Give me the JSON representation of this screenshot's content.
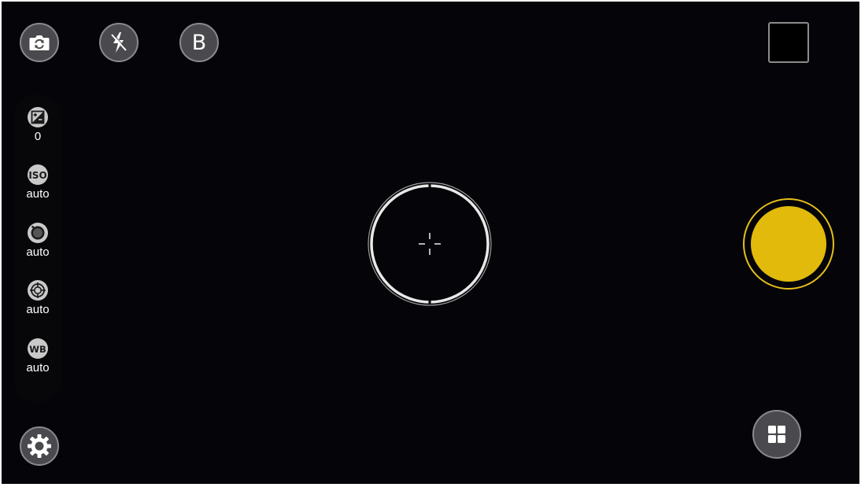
{
  "colors": {
    "viewfinder_bg": "#050408",
    "button_bg": "#4a4a4e",
    "button_border": "#8a8a8e",
    "shutter": "#e1ba0b",
    "shutter_ring": "#e6bf1a"
  },
  "top_bar": {
    "switch_camera_icon": "camera-switch-icon",
    "flash_icon": "flash-auto-icon",
    "mode_label": "B",
    "gallery_thumbnail_icon": "gallery-thumbnail"
  },
  "manual_settings": [
    {
      "name": "exposure-compensation",
      "icon": "exposure-icon",
      "value": "0"
    },
    {
      "name": "iso",
      "icon": "iso-icon",
      "value": "auto"
    },
    {
      "name": "shutter-speed",
      "icon": "shutter-speed-icon",
      "value": "auto"
    },
    {
      "name": "focus",
      "icon": "focus-icon",
      "value": "auto"
    },
    {
      "name": "white-balance",
      "icon": "white-balance-icon",
      "value": "auto"
    }
  ],
  "bottom_bar": {
    "settings_icon": "gear-icon",
    "modes_icon": "grid-icon"
  },
  "viewfinder": {
    "focus_indicator_icon": "focus-ring-icon",
    "shutter_icon": "shutter-button"
  }
}
